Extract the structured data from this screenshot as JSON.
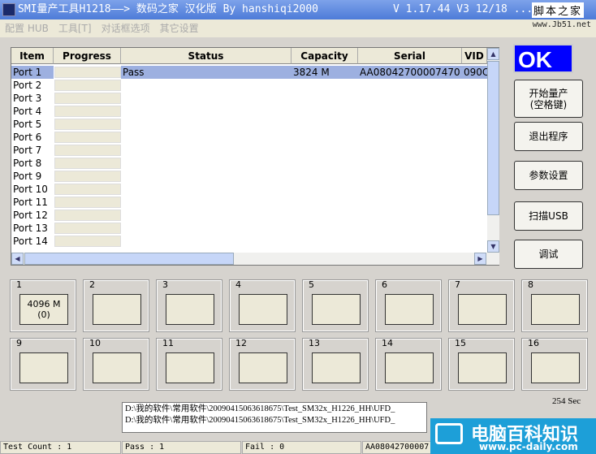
{
  "window": {
    "title": "SMI量产工具H1218——> 数码之家 汉化版 By hanshiqi2000",
    "version": "V 1.17.44 V3 12/18 ...",
    "watermark_top": "脚本之家",
    "watermark_url": "www.Jb51.net"
  },
  "menu": [
    {
      "label": "配置 HUB"
    },
    {
      "label": "工具[T]"
    },
    {
      "label": "对话框选项"
    },
    {
      "label": "其它设置"
    }
  ],
  "table": {
    "columns": [
      "Item",
      "Progress",
      "Status",
      "Capacity",
      "Serial",
      "VID"
    ],
    "rows": [
      {
        "item": "Port 1",
        "status": "Pass",
        "capacity": "3824 M",
        "serial": "AA08042700007470",
        "vid": "090C"
      },
      {
        "item": "Port 2"
      },
      {
        "item": "Port 3"
      },
      {
        "item": "Port 4"
      },
      {
        "item": "Port 5"
      },
      {
        "item": "Port 6"
      },
      {
        "item": "Port 7"
      },
      {
        "item": "Port 8"
      },
      {
        "item": "Port 9"
      },
      {
        "item": "Port 10"
      },
      {
        "item": "Port 11"
      },
      {
        "item": "Port 12"
      },
      {
        "item": "Port 13"
      },
      {
        "item": "Port 14"
      }
    ]
  },
  "ok_label": "OK",
  "buttons": [
    {
      "label": "开始量产\n(空格键)"
    },
    {
      "label": "退出程序"
    },
    {
      "label": "参数设置"
    },
    {
      "label": "扫描USB"
    },
    {
      "label": "调试"
    }
  ],
  "ports": [
    {
      "num": "1",
      "text": "4096 M\n(0)"
    },
    {
      "num": "2"
    },
    {
      "num": "3"
    },
    {
      "num": "4"
    },
    {
      "num": "5"
    },
    {
      "num": "6"
    },
    {
      "num": "7"
    },
    {
      "num": "8"
    },
    {
      "num": "9"
    },
    {
      "num": "10"
    },
    {
      "num": "11"
    },
    {
      "num": "12"
    },
    {
      "num": "13"
    },
    {
      "num": "14"
    },
    {
      "num": "15"
    },
    {
      "num": "16"
    }
  ],
  "log": [
    "D:\\我的软件\\常用软件\\20090415063618675\\Test_SM32x_H1226_HH\\UFD_",
    "D:\\我的软件\\常用软件\\20090415063618675\\Test_SM32x_H1226_HH\\UFD_"
  ],
  "elapsed": "254 Sec",
  "status": {
    "test_count": "Test Count : 1",
    "pass": "Pass : 1",
    "fail": "Fail : 0",
    "serial": "AA08042700007"
  },
  "brand": {
    "name": "电脑百科知识",
    "url": "www.pc-daily.com",
    "color": "#1d9fd8"
  }
}
